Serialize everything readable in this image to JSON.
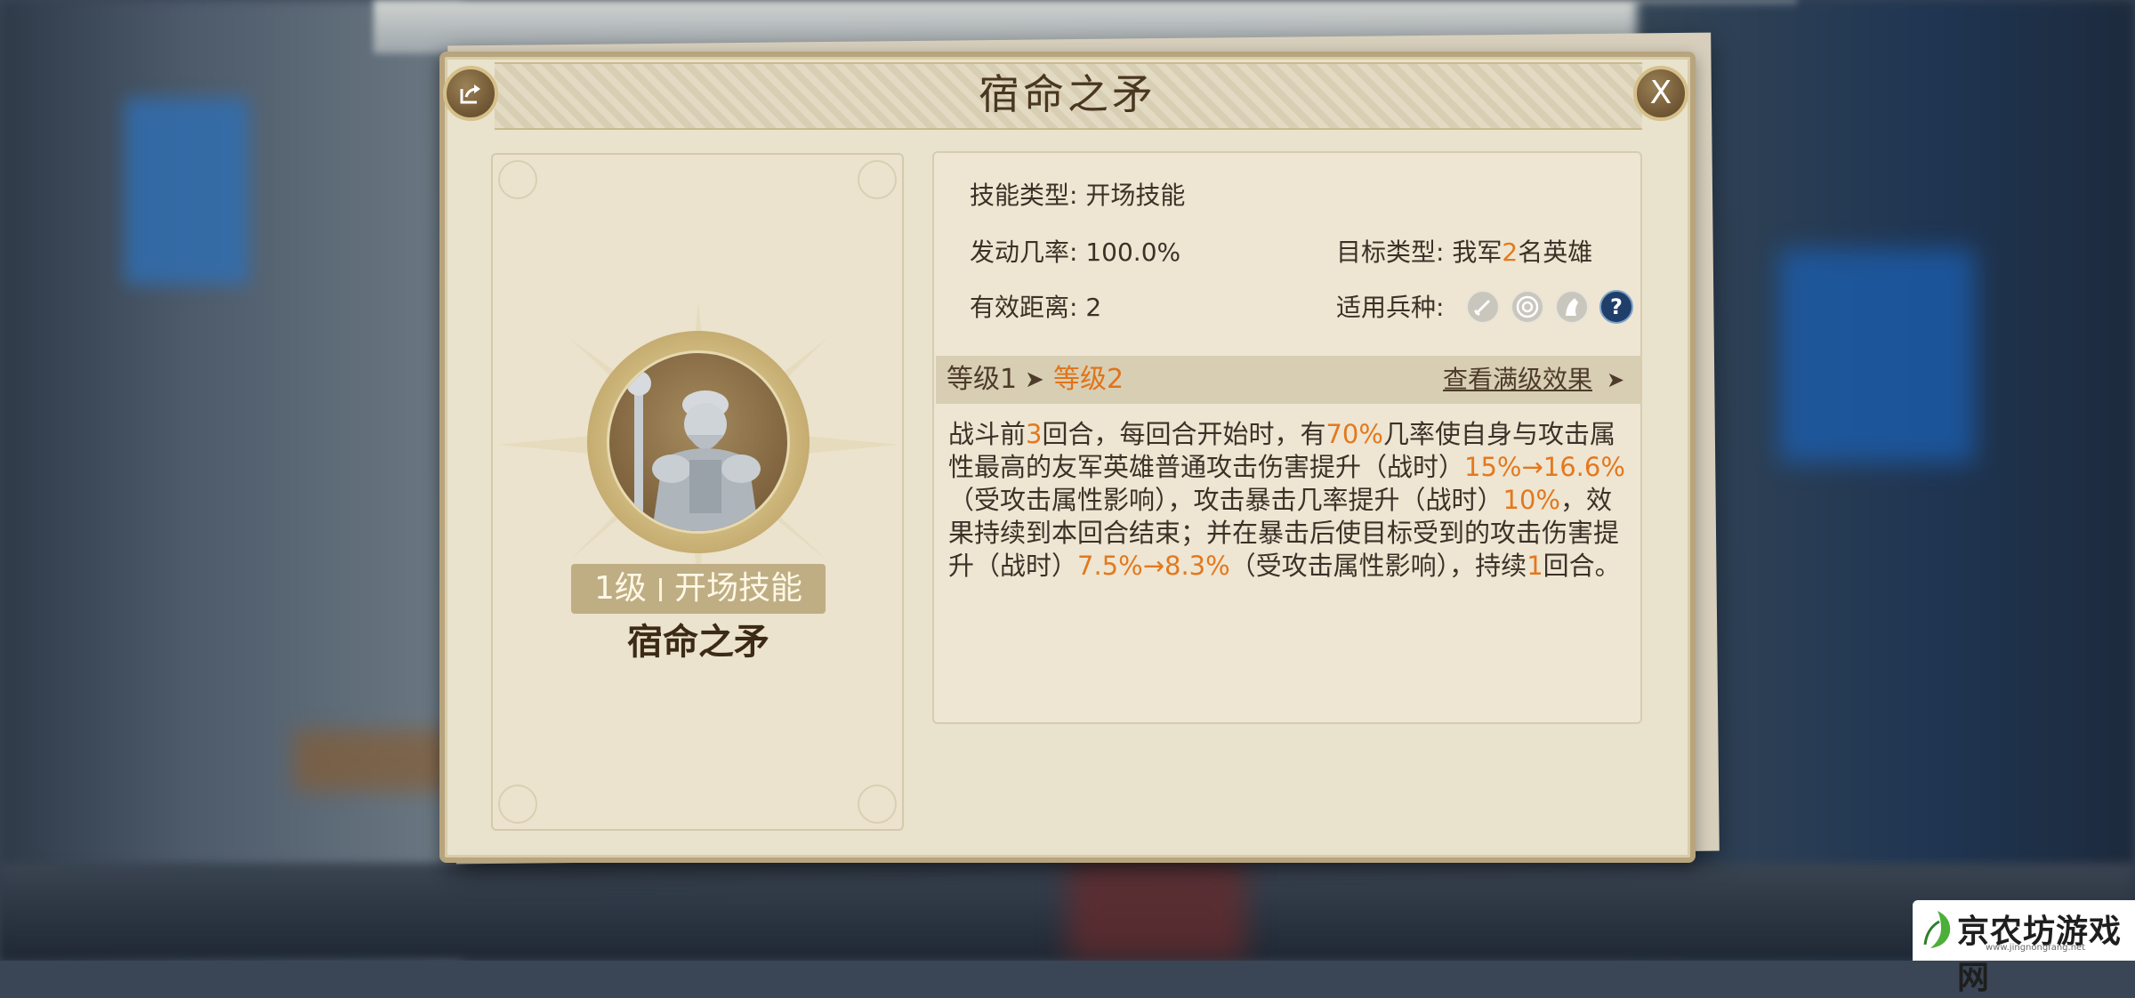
{
  "dialog": {
    "title": "宿命之矛",
    "close_label": "X"
  },
  "skill_card": {
    "level": "1级",
    "type_tag": "开场技能",
    "name": "宿命之矛"
  },
  "details": {
    "skill_type_label": "技能类型:",
    "skill_type_value": "开场技能",
    "trigger_rate_label": "发动几率:",
    "trigger_rate_value": "100.0%",
    "range_label": "有效距离:",
    "range_value": "2",
    "target_type_label": "目标类型:",
    "target_type_prefix": "我军",
    "target_type_count": "2",
    "target_type_suffix": "名英雄",
    "troop_types_label": "适用兵种:",
    "troop_icons": [
      "sword-icon",
      "target-icon",
      "horse-icon",
      "question-icon"
    ]
  },
  "level_bar": {
    "from": "等级1",
    "to": "等级2",
    "view_max": "查看满级效果"
  },
  "description": {
    "segments": [
      {
        "t": "战斗前",
        "hl": false
      },
      {
        "t": "3",
        "hl": true
      },
      {
        "t": "回合，每回合开始时，有",
        "hl": false
      },
      {
        "t": "70%",
        "hl": true
      },
      {
        "t": "几率使自身与攻击属性最高的友军英雄普通攻击伤害提升（战时）",
        "hl": false
      },
      {
        "t": "15%→16.6%",
        "hl": true
      },
      {
        "t": "（受攻击属性影响），攻击暴击几率提升（战时）",
        "hl": false
      },
      {
        "t": "10%",
        "hl": true
      },
      {
        "t": "，效果持续到本回合结束；并在暴击后使目标受到的攻击伤害提升（战时）",
        "hl": false
      },
      {
        "t": "7.5%→8.3%",
        "hl": true
      },
      {
        "t": "（受攻击属性影响），持续",
        "hl": false
      },
      {
        "t": "1",
        "hl": true
      },
      {
        "t": "回合。",
        "hl": false
      }
    ]
  },
  "watermark": {
    "text": "京农坊游戏网",
    "sub": "www.jingnongfang.net"
  },
  "colors": {
    "highlight": "#e4781e",
    "parchment": "#e9e2cc",
    "frame": "#b8a57e",
    "title_text": "#4a3720"
  }
}
